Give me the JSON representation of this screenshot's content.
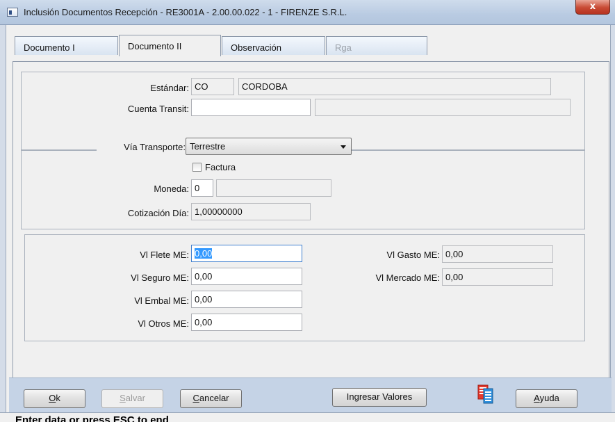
{
  "window": {
    "title": "Inclusión Documentos Recepción - RE3001A - 2.00.00.022 - 1 - FIRENZE S.R.L.",
    "close_glyph": "x"
  },
  "tabs": [
    {
      "label": "Documento  I"
    },
    {
      "label": "Documento II"
    },
    {
      "label": "Observación"
    },
    {
      "label": "Rga"
    }
  ],
  "section1": {
    "estandar_label": "Estándar:",
    "estandar_code": "CO",
    "estandar_name": "CORDOBA",
    "cuenta_label": "Cuenta Transit:",
    "cuenta_value": "",
    "cuenta_desc": ""
  },
  "section2": {
    "via_label": "Vía Transporte:",
    "via_value": "Terrestre",
    "factura_label": "Factura",
    "moneda_label": "Moneda:",
    "moneda_value": "0",
    "moneda_desc": "",
    "cotizacion_label": "Cotización Día:",
    "cotizacion_value": "1,00000000"
  },
  "section3": {
    "flete_label": "Vl Flete ME:",
    "flete_value": "0,00",
    "seguro_label": "Vl Seguro ME:",
    "seguro_value": "0,00",
    "embal_label": "Vl Embal ME:",
    "embal_value": "0,00",
    "otros_label": "Vl Otros ME:",
    "otros_value": "0,00",
    "gasto_label": "Vl Gasto ME:",
    "gasto_value": "0,00",
    "mercado_label": "Vl Mercado ME:",
    "mercado_value": "0,00"
  },
  "buttons": {
    "ok_acc": "O",
    "ok_rest": "k",
    "salvar_acc": "S",
    "salvar_rest": "alvar",
    "cancelar_acc": "C",
    "cancelar_rest": "ancelar",
    "ingresar": "Ingresar Valores",
    "ayuda_acc": "A",
    "ayuda_rest": "yuda"
  },
  "status": {
    "text": "Enter data or press ESC to end"
  },
  "icons": {
    "document": "document-list-icon",
    "app": "app-window-icon"
  }
}
